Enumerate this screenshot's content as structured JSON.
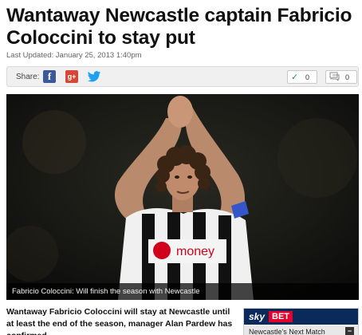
{
  "article": {
    "headline": "Wantaway Newcastle captain Fabricio Coloccini to stay put",
    "last_updated": "Last Updated: January 25, 2013 1:40pm",
    "photo_caption": "Fabricio Coloccini: Will finish the season with Newcastle",
    "photo_shirt_sponsor": "money",
    "intro": "Wantaway Fabricio Coloccini will stay at Newcastle until at least the end of the season, manager Alan Pardew has confirmed."
  },
  "share": {
    "label": "Share:",
    "facebook_glyph": "f",
    "googleplus_glyph": "g+",
    "counters": [
      {
        "icon": "check-icon",
        "glyph": "✓",
        "value": "0"
      },
      {
        "icon": "comment-icon",
        "glyph": "💬",
        "value": "0"
      }
    ]
  },
  "betting": {
    "brand_sky": "sky",
    "brand_bet": "BET",
    "next_match": "Newcastle's Next Match",
    "collapse_glyph": "−"
  },
  "colors": {
    "facebook": "#3b5998",
    "googleplus": "#d34836",
    "twitter": "#1da1f2",
    "skybet_navy": "#0a2a5c",
    "skybet_red": "#e3002b"
  }
}
